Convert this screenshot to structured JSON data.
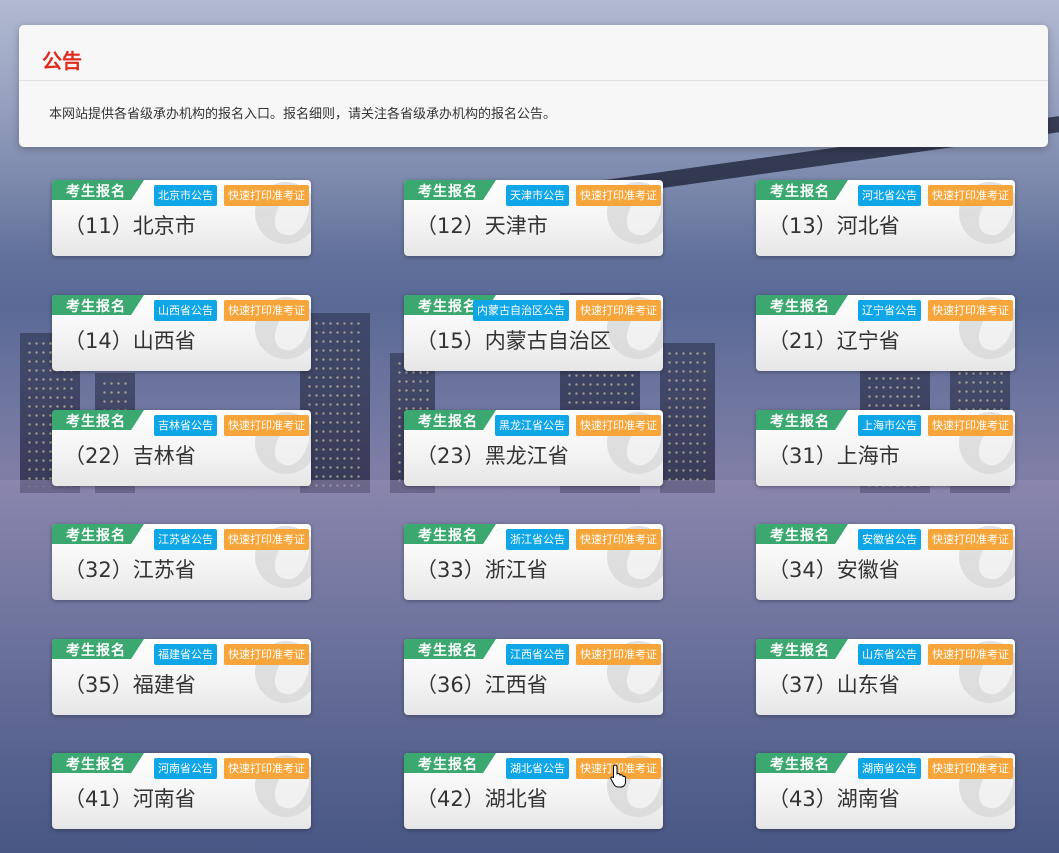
{
  "notice": {
    "title": "公告",
    "text": "本网站提供各省级承办机构的报名入口。报名细则，请关注各省级承办机构的报名公告。"
  },
  "card_labels": {
    "register": "考生报名",
    "print": "快速打印准考证"
  },
  "cards": [
    {
      "name": "（11）北京市",
      "notice": "北京市公告"
    },
    {
      "name": "（12）天津市",
      "notice": "天津市公告"
    },
    {
      "name": "（13）河北省",
      "notice": "河北省公告"
    },
    {
      "name": "（14）山西省",
      "notice": "山西省公告"
    },
    {
      "name": "（15）内蒙古自治区",
      "notice": "内蒙古自治区公告"
    },
    {
      "name": "（21）辽宁省",
      "notice": "辽宁省公告"
    },
    {
      "name": "（22）吉林省",
      "notice": "吉林省公告"
    },
    {
      "name": "（23）黑龙江省",
      "notice": "黑龙江省公告"
    },
    {
      "name": "（31）上海市",
      "notice": "上海市公告"
    },
    {
      "name": "（32）江苏省",
      "notice": "江苏省公告"
    },
    {
      "name": "（33）浙江省",
      "notice": "浙江省公告"
    },
    {
      "name": "（34）安徽省",
      "notice": "安徽省公告"
    },
    {
      "name": "（35）福建省",
      "notice": "福建省公告"
    },
    {
      "name": "（36）江西省",
      "notice": "江西省公告"
    },
    {
      "name": "（37）山东省",
      "notice": "山东省公告"
    },
    {
      "name": "（41）河南省",
      "notice": "河南省公告"
    },
    {
      "name": "（42）湖北省",
      "notice": "湖北省公告"
    },
    {
      "name": "（43）湖南省",
      "notice": "湖南省公告"
    }
  ],
  "colors": {
    "title_red": "#e02a1b",
    "register_green": "#3aa86f",
    "notice_blue": "#0fa6e8",
    "print_orange": "#f6a53a"
  }
}
